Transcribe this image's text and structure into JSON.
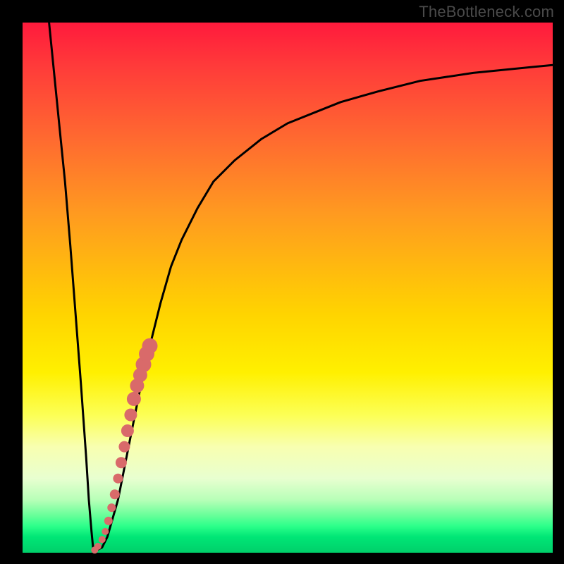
{
  "watermark": "TheBottleneck.com",
  "colors": {
    "frame": "#000000",
    "curve": "#000000",
    "dots": "#d96a6a",
    "gradient_stops": [
      {
        "pos": 0.0,
        "color": "#ff1a3c"
      },
      {
        "pos": 0.08,
        "color": "#ff3a3a"
      },
      {
        "pos": 0.22,
        "color": "#ff6a30"
      },
      {
        "pos": 0.36,
        "color": "#ff9a20"
      },
      {
        "pos": 0.55,
        "color": "#ffd400"
      },
      {
        "pos": 0.66,
        "color": "#fff000"
      },
      {
        "pos": 0.74,
        "color": "#fcff55"
      },
      {
        "pos": 0.8,
        "color": "#f8ffb0"
      },
      {
        "pos": 0.86,
        "color": "#e8ffd0"
      },
      {
        "pos": 0.9,
        "color": "#b8ffb8"
      },
      {
        "pos": 0.93,
        "color": "#66ff99"
      },
      {
        "pos": 0.95,
        "color": "#2cff8a"
      },
      {
        "pos": 0.97,
        "color": "#00e676"
      },
      {
        "pos": 1.0,
        "color": "#00d06a"
      }
    ]
  },
  "chart_data": {
    "type": "line",
    "title": "",
    "xlabel": "",
    "ylabel": "",
    "xlim": [
      0,
      100
    ],
    "ylim": [
      0,
      100
    ],
    "series": [
      {
        "name": "bottleneck-curve",
        "x": [
          5,
          6,
          7,
          8,
          9,
          10,
          11,
          12,
          12.5,
          13,
          13.3,
          13.6,
          14,
          15,
          16,
          18,
          20,
          22,
          24,
          26,
          28,
          30,
          33,
          36,
          40,
          45,
          50,
          55,
          60,
          67,
          75,
          85,
          100
        ],
        "y": [
          100,
          90,
          80,
          70,
          58,
          45,
          32,
          18,
          10,
          4,
          1,
          0.5,
          0.5,
          1,
          3,
          10,
          20,
          30,
          39,
          47,
          54,
          59,
          65,
          70,
          74,
          78,
          81,
          83,
          85,
          87,
          89,
          90.5,
          92
        ]
      }
    ],
    "dots": {
      "name": "sample-points",
      "x": [
        13.6,
        14.2,
        15.0,
        15.6,
        16.2,
        16.8,
        17.4,
        18.0,
        18.6,
        19.2,
        19.8,
        20.4,
        21.0,
        21.6,
        22.2,
        22.8,
        23.4,
        24.0
      ],
      "y": [
        0.5,
        1.2,
        2.5,
        4.0,
        6.0,
        8.5,
        11.0,
        14.0,
        17.0,
        20.0,
        23.0,
        26.0,
        29.0,
        31.5,
        33.5,
        35.5,
        37.5,
        39.0
      ],
      "r": [
        5,
        5,
        5,
        5,
        6,
        6,
        7,
        7,
        8,
        8,
        9,
        9,
        10,
        10,
        10,
        11,
        11,
        11
      ]
    }
  }
}
